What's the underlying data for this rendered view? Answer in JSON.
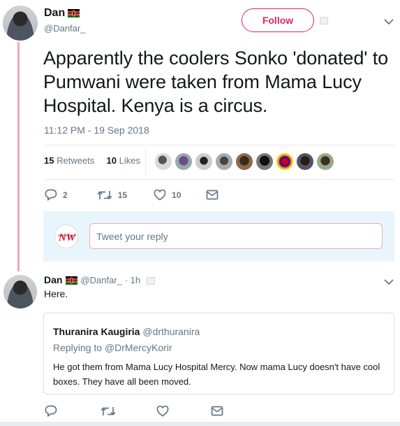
{
  "main_tweet": {
    "author_name": "Dan",
    "author_handle": "@Danfar_",
    "follow_label": "Follow",
    "text": "Apparently the coolers Sonko 'donated' to Pumwani were taken from Mama Lucy Hospital. Kenya is a circus.",
    "timestamp": "11:12 PM - 19 Sep 2018",
    "retweets_count": "15",
    "retweets_label": "Retweets",
    "likes_count": "10",
    "likes_label": "Likes",
    "actions": {
      "replies": "2",
      "retweets": "15",
      "likes": "10"
    }
  },
  "reply_composer": {
    "logo_text": "NW",
    "placeholder": "Tweet your reply"
  },
  "reply_tweet": {
    "author_name": "Dan",
    "author_handle": "@Danfar_",
    "age": "· 1h",
    "text": "Here.",
    "quoted": {
      "author_name": "Thuranira Kaugiria",
      "author_handle": "@drthuranira",
      "replying_to": "Replying to @DrMercyKorir",
      "text": "He got them from Mama Lucy Hospital Mercy. Now mama Lucy doesn't have cool boxes. They have all been moved."
    }
  },
  "colors": {
    "accent": "#e0245e",
    "thread_line": "#f4a6b4",
    "muted": "#657786",
    "link_blue": "#1da1f2"
  },
  "icons": [
    "flag-kenya-icon",
    "chevron-down-icon",
    "reply-icon",
    "retweet-icon",
    "like-icon",
    "message-icon"
  ]
}
